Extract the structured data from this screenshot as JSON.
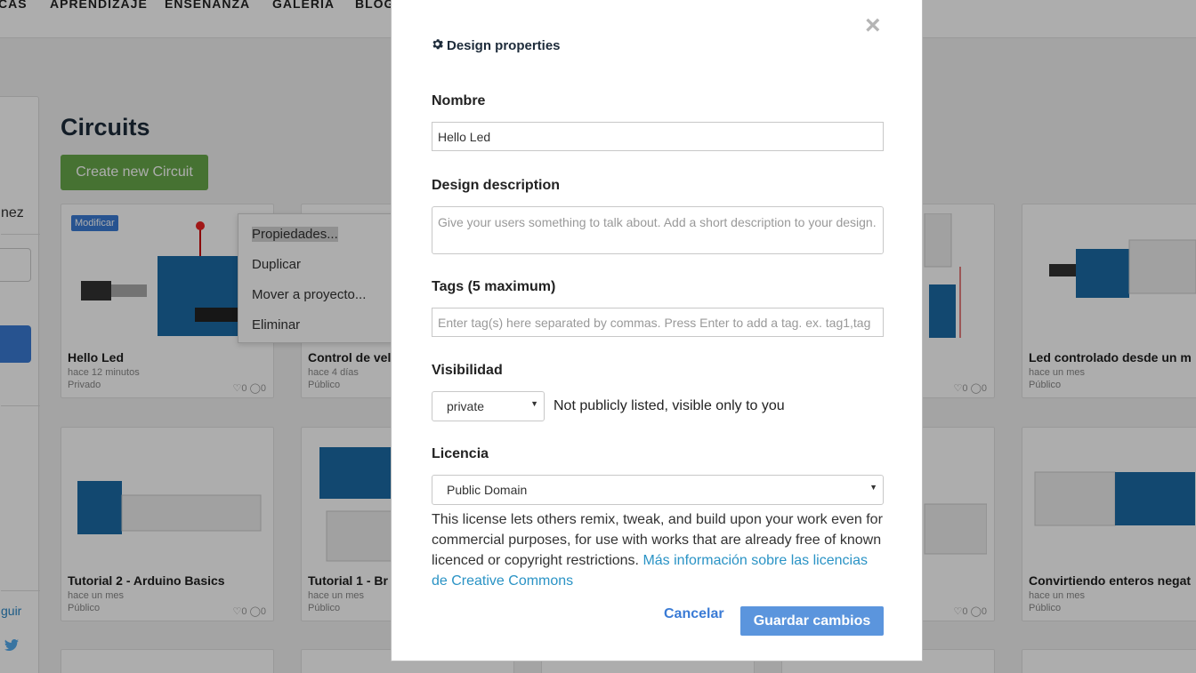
{
  "topnav": {
    "items": [
      "CAS",
      "APRENDIZAJE",
      "ENSEÑANZA",
      "GALERIA",
      "BLOG"
    ]
  },
  "sidebar": {
    "name_fragment": "nez",
    "follow_fragment": "guir"
  },
  "page": {
    "title": "Circuits",
    "create_button": "Create new Circuit",
    "modify_badge": "Modificar"
  },
  "cards": [
    {
      "title": "Hello Led",
      "time": "hace 12 minutos",
      "visibility": "Privado",
      "stats": "♡0 ◯0"
    },
    {
      "title": "Control de vel",
      "time": "hace 4 días",
      "visibility": "Público",
      "stats": ""
    },
    {
      "title": "",
      "time": "",
      "visibility": "",
      "stats": "♡0 ◯0"
    },
    {
      "title": "Led controlado desde un m",
      "time": "hace un mes",
      "visibility": "Público",
      "stats": "♡"
    },
    {
      "title": "Tutorial 2 - Arduino Basics",
      "time": "hace un mes",
      "visibility": "Público",
      "stats": "♡0 ◯0"
    },
    {
      "title": "Tutorial 1 - Br",
      "time": "hace un mes",
      "visibility": "Público",
      "stats": ""
    },
    {
      "title": "",
      "time": "",
      "visibility": "",
      "stats": "♡0 ◯0"
    },
    {
      "title": "Convirtiendo enteros negat",
      "time": "hace un mes",
      "visibility": "Público",
      "stats": "♡"
    }
  ],
  "context_menu": {
    "items": [
      "Propiedades...",
      "Duplicar",
      "Mover a proyecto...",
      "Eliminar"
    ]
  },
  "modal": {
    "header": "Design properties",
    "header_icon": "gear-icon",
    "close_symbol": "×",
    "name_label": "Nombre",
    "name_value": "Hello Led",
    "description_label": "Design description",
    "description_placeholder": "Give your users something to talk about. Add a short description to your design.",
    "tags_label": "Tags (5 maximum)",
    "tags_placeholder": "Enter tag(s) here separated by commas. Press Enter to add a tag. ex. tag1,tag",
    "visibility_label": "Visibilidad",
    "visibility_value": "private",
    "visibility_note": "Not publicly listed, visible only to you",
    "license_label": "Licencia",
    "license_value": "Public Domain",
    "license_text": "This license lets others remix, tweak, and build upon your work even for commercial purposes, for use with works that are already free of known licenced or copyright restrictions.",
    "license_link": "Más información sobre las licencias de Creative Commons",
    "cancel_label": "Cancelar",
    "save_label": "Guardar cambios"
  },
  "colors": {
    "accent": "#3a7bd5",
    "create_button": "#67a94a",
    "save_button": "#5b95dd",
    "link": "#2a93c5"
  }
}
